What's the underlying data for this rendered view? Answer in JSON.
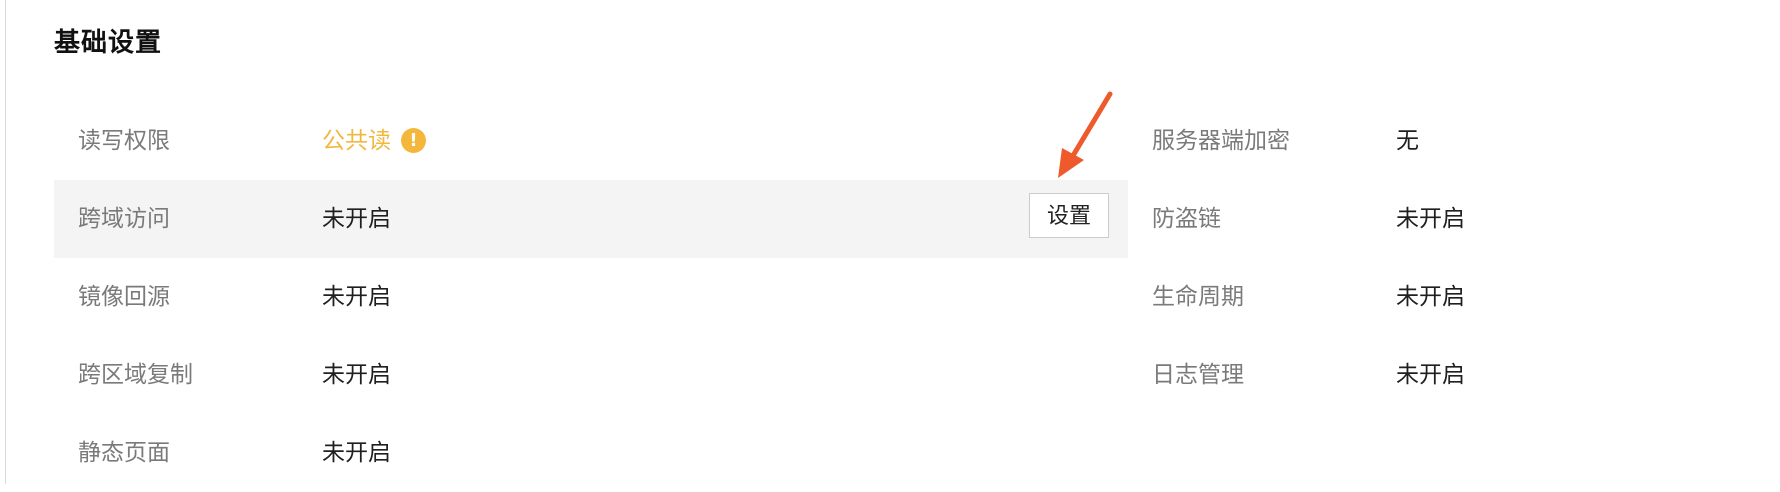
{
  "section": {
    "title": "基础设置"
  },
  "left_rows": [
    {
      "label": "读写权限",
      "value": "公共读",
      "status": "warning"
    },
    {
      "label": "跨域访问",
      "value": "未开启",
      "action": "设置"
    },
    {
      "label": "镜像回源",
      "value": "未开启"
    },
    {
      "label": "跨区域复制",
      "value": "未开启"
    },
    {
      "label": "静态页面",
      "value": "未开启"
    }
  ],
  "right_rows": [
    {
      "label": "服务器端加密",
      "value": "无"
    },
    {
      "label": "防盗链",
      "value": "未开启"
    },
    {
      "label": "生命周期",
      "value": "未开启"
    },
    {
      "label": "日志管理",
      "value": "未开启"
    }
  ],
  "icons": {
    "warning": "warning-icon",
    "annotation": "red-arrow"
  },
  "colors": {
    "warning_text": "#f0b840",
    "warning_icon": "#f5b73b",
    "highlight_row": "#f4f4f4",
    "arrow": "#ee5a2c"
  }
}
